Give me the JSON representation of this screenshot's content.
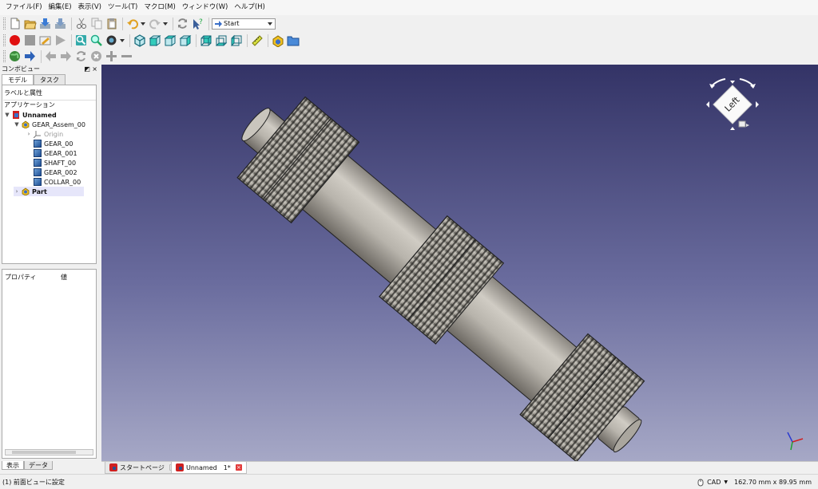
{
  "menu": [
    "ファイル(F)",
    "編集(E)",
    "表示(V)",
    "ツール(T)",
    "マクロ(M)",
    "ウィンドウ(W)",
    "ヘルプ(H)"
  ],
  "toolbar": {
    "workbench_selected": "Start",
    "icons_row1": [
      "new-file-icon",
      "open-file-icon",
      "save-icon",
      "save-as-icon",
      "cut-icon",
      "copy-icon",
      "paste-icon",
      "undo-icon",
      "redo-icon",
      "refresh-icon",
      "whats-this-icon"
    ],
    "icons_row2": [
      "record-macro-icon",
      "stop-macro-icon",
      "edit-macro-icon",
      "run-macro-icon",
      "fit-all-icon",
      "fit-selection-icon",
      "draw-style-icon",
      "view-isometric-icon",
      "view-front-icon",
      "view-top-icon",
      "view-right-icon",
      "view-rear-icon",
      "view-bottom-icon",
      "view-left-icon",
      "measure-icon",
      "create-part-icon",
      "create-group-icon"
    ],
    "icons_row3": [
      "web-home-icon",
      "web-forward-nav-icon",
      "web-back-icon",
      "web-next-icon",
      "web-refresh-icon",
      "web-stop-icon",
      "zoom-in-icon",
      "zoom-out-icon"
    ]
  },
  "combo": {
    "title": "コンボビュー",
    "title_controls": "◩ ×",
    "tabs": [
      "モデル",
      "タスク"
    ],
    "section_labels": "ラベルと属性",
    "section_app": "アプリケーション",
    "tree": [
      {
        "label": "Unnamed",
        "bold": true,
        "twisty": "▼",
        "icon": "document-icon"
      },
      {
        "label": "GEAR_Assem_00",
        "bold": false,
        "twisty": "▼",
        "icon": "assembly-icon"
      },
      {
        "label": "Origin",
        "bold": false,
        "twisty": "›",
        "icon": "origin-icon",
        "dim": true
      },
      {
        "label": "GEAR_00",
        "bold": false,
        "twisty": "",
        "icon": "solid-icon"
      },
      {
        "label": "GEAR_001",
        "bold": false,
        "twisty": "",
        "icon": "solid-icon"
      },
      {
        "label": "SHAFT_00",
        "bold": false,
        "twisty": "",
        "icon": "solid-icon"
      },
      {
        "label": "GEAR_002",
        "bold": false,
        "twisty": "",
        "icon": "solid-icon"
      },
      {
        "label": "COLLAR_00",
        "bold": false,
        "twisty": "",
        "icon": "solid-icon"
      },
      {
        "label": "Part",
        "bold": true,
        "twisty": "›",
        "icon": "part-icon",
        "selected": true
      }
    ],
    "props_header_prop": "プロパティ",
    "props_header_val": "値",
    "bottom_tabs": [
      "表示",
      "データ"
    ]
  },
  "viewport": {
    "navcube_face": "Left"
  },
  "doc_tabs": [
    {
      "label": "スタートページ",
      "active": false
    },
    {
      "label": "Unnamed　1*",
      "active": true
    }
  ],
  "status": {
    "message": "(1) 前面ビューに設定",
    "nav_style": "CAD",
    "dimensions": "162.70 mm x 89.95 mm"
  }
}
